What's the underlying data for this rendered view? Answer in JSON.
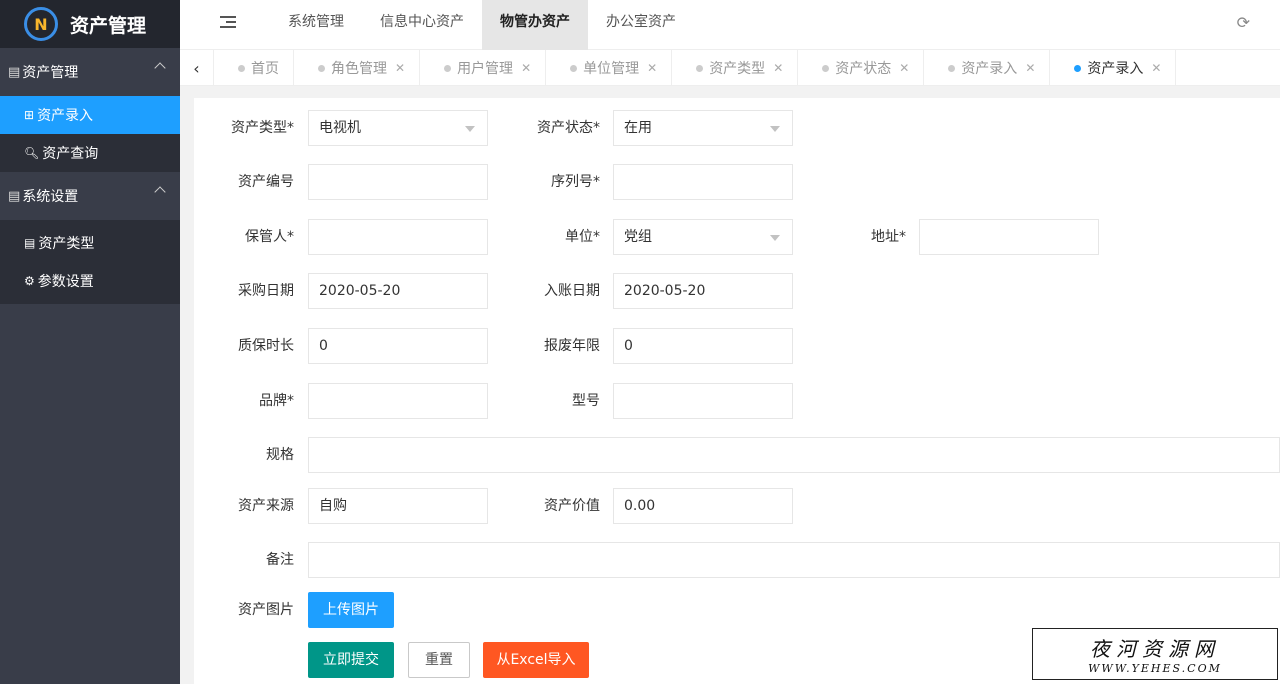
{
  "sidebar": {
    "logo_mark": "N",
    "app_title": "资产管理",
    "groups": [
      {
        "label": "资产管理",
        "items": [
          {
            "label": "资产录入"
          },
          {
            "label": "资产查询"
          }
        ]
      },
      {
        "label": "系统设置",
        "items": [
          {
            "label": "资产类型"
          },
          {
            "label": "参数设置"
          }
        ]
      }
    ]
  },
  "topbar": {
    "tabs": [
      {
        "label": "系统管理"
      },
      {
        "label": "信息中心资产"
      },
      {
        "label": "物管办资产"
      },
      {
        "label": "办公室资产"
      }
    ]
  },
  "pagetabs": [
    {
      "label": "首页"
    },
    {
      "label": "角色管理"
    },
    {
      "label": "用户管理"
    },
    {
      "label": "单位管理"
    },
    {
      "label": "资产类型"
    },
    {
      "label": "资产状态"
    },
    {
      "label": "资产录入"
    },
    {
      "label": "资产录入"
    }
  ],
  "form": {
    "asset_type": {
      "label": "资产类型*",
      "value": "电视机"
    },
    "asset_status": {
      "label": "资产状态*",
      "value": "在用"
    },
    "asset_no": {
      "label": "资产编号",
      "value": ""
    },
    "serial_no": {
      "label": "序列号*",
      "value": ""
    },
    "keeper": {
      "label": "保管人*",
      "value": ""
    },
    "unit": {
      "label": "单位*",
      "value": "党组"
    },
    "address": {
      "label": "地址*",
      "value": ""
    },
    "purchase_date": {
      "label": "采购日期",
      "value": "2020-05-20"
    },
    "entry_date": {
      "label": "入账日期",
      "value": "2020-05-20"
    },
    "warranty": {
      "label": "质保时长",
      "value": "0"
    },
    "scrap_years": {
      "label": "报废年限",
      "value": "0"
    },
    "brand": {
      "label": "品牌*",
      "value": ""
    },
    "model": {
      "label": "型号",
      "value": ""
    },
    "spec": {
      "label": "规格",
      "value": ""
    },
    "source": {
      "label": "资产来源",
      "value": "自购"
    },
    "value": {
      "label": "资产价值",
      "value": "0.00"
    },
    "remark": {
      "label": "备注",
      "value": ""
    },
    "image": {
      "label": "资产图片"
    },
    "buttons": {
      "upload": "上传图片",
      "submit": "立即提交",
      "reset": "重置",
      "excel": "从Excel导入"
    }
  },
  "watermark": {
    "title": "夜河资源网",
    "url": "WWW.YEHES.COM"
  },
  "colors": {
    "sidebar_bg": "#393d49",
    "active_blue": "#1e9fff",
    "submit_green": "#009688",
    "excel_orange": "#ff5722"
  }
}
